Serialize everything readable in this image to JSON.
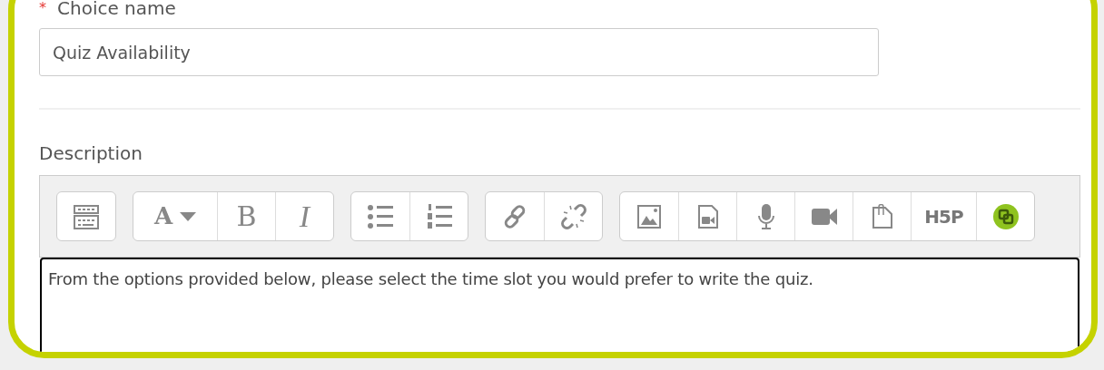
{
  "name_field": {
    "label": "Choice name",
    "required_mark": "*",
    "value": "Quiz Availability"
  },
  "description": {
    "label": "Description",
    "toolbar": [
      {
        "buttons": [
          {
            "kind": "more"
          }
        ]
      },
      {
        "buttons": [
          {
            "kind": "font",
            "label": "A"
          },
          {
            "kind": "bold",
            "label": "B"
          },
          {
            "kind": "italic",
            "label": "I"
          }
        ]
      },
      {
        "buttons": [
          {
            "kind": "bullets"
          },
          {
            "kind": "numbers"
          }
        ]
      },
      {
        "buttons": [
          {
            "kind": "link"
          },
          {
            "kind": "unlink"
          }
        ]
      },
      {
        "buttons": [
          {
            "kind": "image"
          },
          {
            "kind": "media"
          },
          {
            "kind": "audio"
          },
          {
            "kind": "video"
          },
          {
            "kind": "file"
          },
          {
            "kind": "h5p",
            "label": "H5P"
          },
          {
            "kind": "plugin"
          }
        ]
      }
    ],
    "text": "From the options provided below, please select the time slot you would prefer to write the quiz."
  }
}
